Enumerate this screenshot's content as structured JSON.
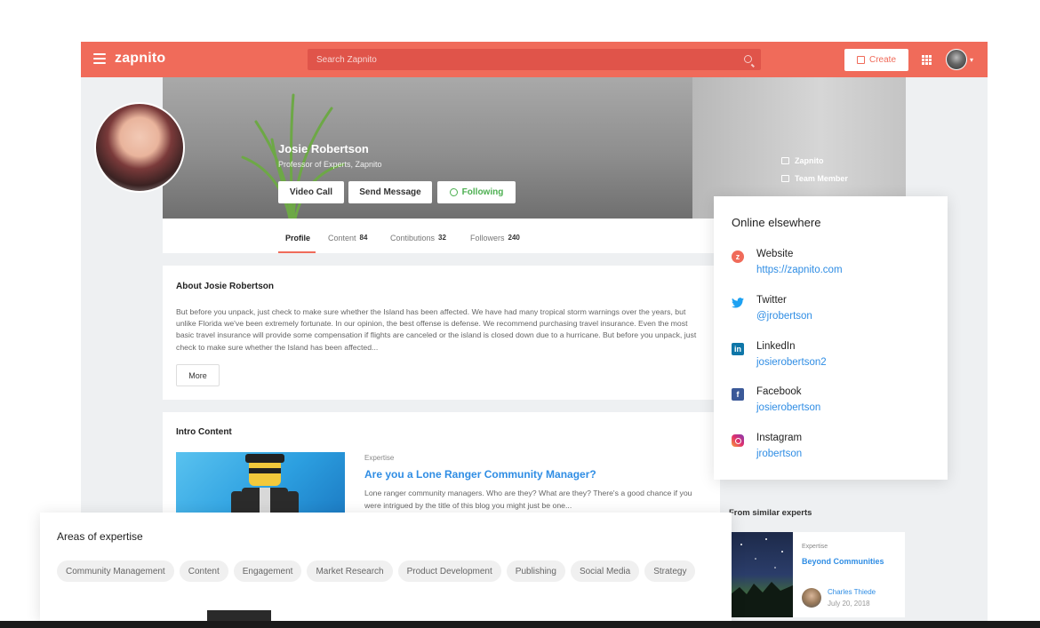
{
  "app": {
    "logo": "zapnito"
  },
  "topbar": {
    "search_placeholder": "Search Zapnito",
    "create_label": "Create"
  },
  "profile": {
    "name": "Josie Robertson",
    "role": "Professor of Experts, Zapnito",
    "buttons": {
      "video_call": "Video Call",
      "send_message": "Send Message",
      "following": "Following"
    },
    "meta": {
      "org": "Zapnito",
      "membership": "Team Member"
    }
  },
  "tabs": [
    {
      "label": "Profile",
      "count": ""
    },
    {
      "label": "Content",
      "count": "84"
    },
    {
      "label": "Contibutions",
      "count": "32"
    },
    {
      "label": "Followers",
      "count": "240"
    }
  ],
  "about": {
    "title": "About Josie Robertson",
    "text": "But before you unpack, just check to make sure whether the Island has been affected. We have had many tropical storm warnings over the years, but unlike Florida we've been extremely fortunate. In our opinion, the best offense is defense. We recommend purchasing travel insurance. Even the most basic travel insurance will provide some compensation if flights are canceled or the island is closed down due to a hurricane. But before you unpack, just check to make sure whether the Island has been affected...",
    "more_label": "More"
  },
  "intro": {
    "title": "Intro Content",
    "tag": "Expertise",
    "heading": "Are you a Lone Ranger Community Manager?",
    "description": "Lone ranger community managers. Who are they? What are they? There's a good chance if you were intrigued by the title of this blog you might just be one..."
  },
  "similar": {
    "title": "From similar experts",
    "tag": "Expertise",
    "heading": "Beyond Communities",
    "author": "Charles Thiede",
    "date": "July 20, 2018"
  },
  "online": {
    "title": "Online elsewhere",
    "items": [
      {
        "label": "Website",
        "link": "https://zapnito.com",
        "icon": "website-icon",
        "color": "#f06b5a"
      },
      {
        "label": "Twitter",
        "link": "@jrobertson",
        "icon": "twitter-icon",
        "color": "#1da1f2"
      },
      {
        "label": "LinkedIn",
        "link": "josierobertson2",
        "icon": "linkedin-icon",
        "color": "#0e76a8"
      },
      {
        "label": "Facebook",
        "link": "josierobertson",
        "icon": "facebook-icon",
        "color": "#3b5998"
      },
      {
        "label": "Instagram",
        "link": "jrobertson",
        "icon": "instagram-icon",
        "color": "#c13584"
      }
    ]
  },
  "areas": {
    "title": "Areas of expertise",
    "chips": [
      "Community Management",
      "Content",
      "Engagement",
      "Market Research",
      "Product Development",
      "Publishing",
      "Social Media",
      "Strategy"
    ]
  },
  "colors": {
    "brand": "#f06b5a",
    "link": "#2f8de4",
    "following": "#4caf50"
  }
}
